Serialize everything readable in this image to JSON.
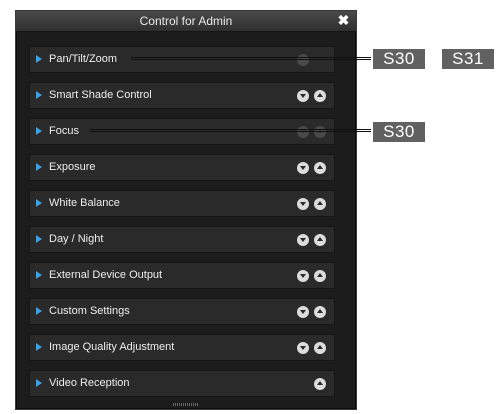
{
  "dialog": {
    "title": "Control for Admin",
    "close_glyph": "✖"
  },
  "rows": [
    {
      "label": "Pan/Tilt/Zoom",
      "controls": [
        "dim"
      ]
    },
    {
      "label": "Smart Shade Control",
      "controls": [
        "down",
        "up"
      ]
    },
    {
      "label": "Focus",
      "controls": [
        "dim-down",
        "dim-up"
      ]
    },
    {
      "label": "Exposure",
      "controls": [
        "down",
        "up"
      ]
    },
    {
      "label": "White Balance",
      "controls": [
        "down",
        "up"
      ]
    },
    {
      "label": "Day / Night",
      "controls": [
        "down",
        "up"
      ]
    },
    {
      "label": "External Device Output",
      "controls": [
        "down",
        "up"
      ]
    },
    {
      "label": "Custom Settings",
      "controls": [
        "down",
        "up"
      ]
    },
    {
      "label": "Image Quality Adjustment",
      "controls": [
        "down",
        "up"
      ]
    },
    {
      "label": "Video Reception",
      "controls": [
        "up"
      ]
    }
  ],
  "callouts": {
    "ptz": [
      "S30",
      "S31"
    ],
    "focus": [
      "S30"
    ]
  },
  "colors": {
    "accent_arrow": "#3aa0e6",
    "badge_bg": "#616161",
    "panel_bg": "#1c1c1c"
  }
}
